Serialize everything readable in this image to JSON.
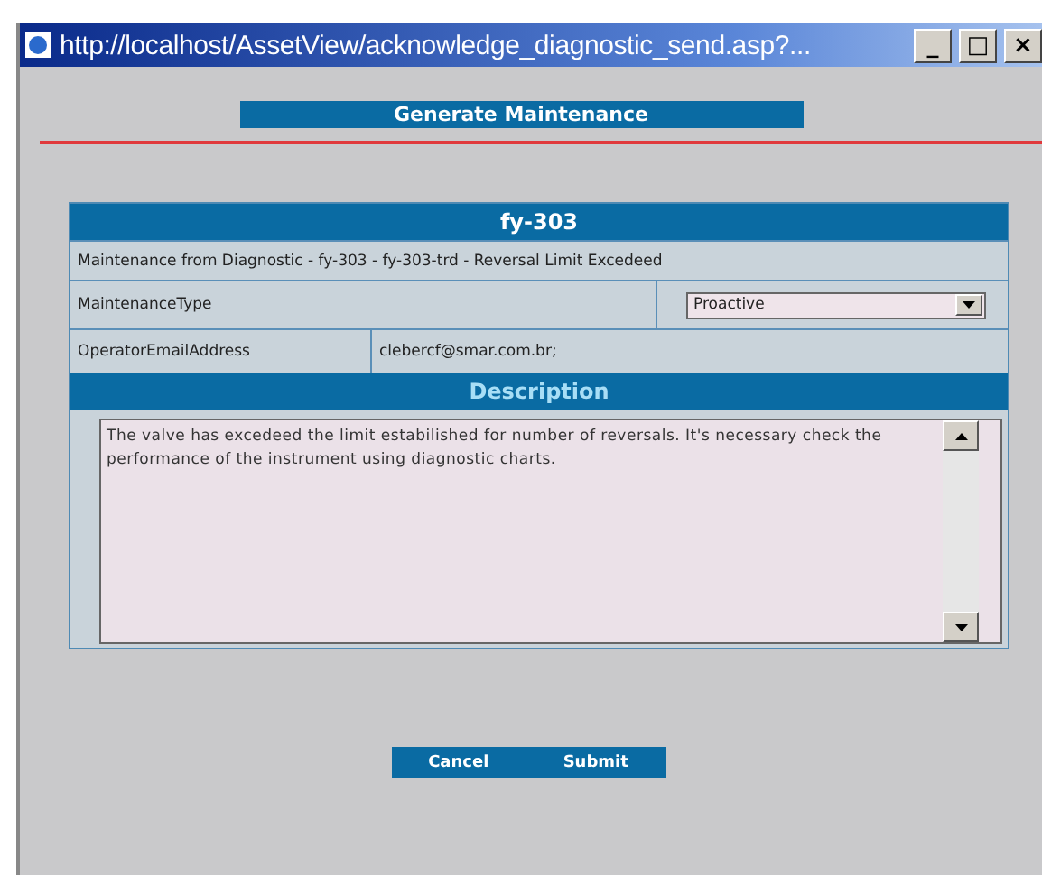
{
  "window": {
    "title": "http://localhost/AssetView/acknowledge_diagnostic_send.asp?...",
    "controls": [
      "_",
      "□",
      "×"
    ]
  },
  "heading": "Generate Maintenance",
  "form": {
    "title": "fy-303",
    "summary": "Maintenance from Diagnostic - fy-303 - fy-303-trd - Reversal Limit Excedeed",
    "maintenance_type": {
      "label": "MaintenanceType",
      "value": "Proactive"
    },
    "operator_email": {
      "label": "OperatorEmailAddress",
      "value": "clebercf@smar.com.br;"
    },
    "description": {
      "label": "Description",
      "value": "The valve has excedeed the limit estabilished for number of reversals. It's necessary check the performance of the instrument using diagnostic charts."
    }
  },
  "buttons": [
    "Cancel",
    "Submit"
  ]
}
